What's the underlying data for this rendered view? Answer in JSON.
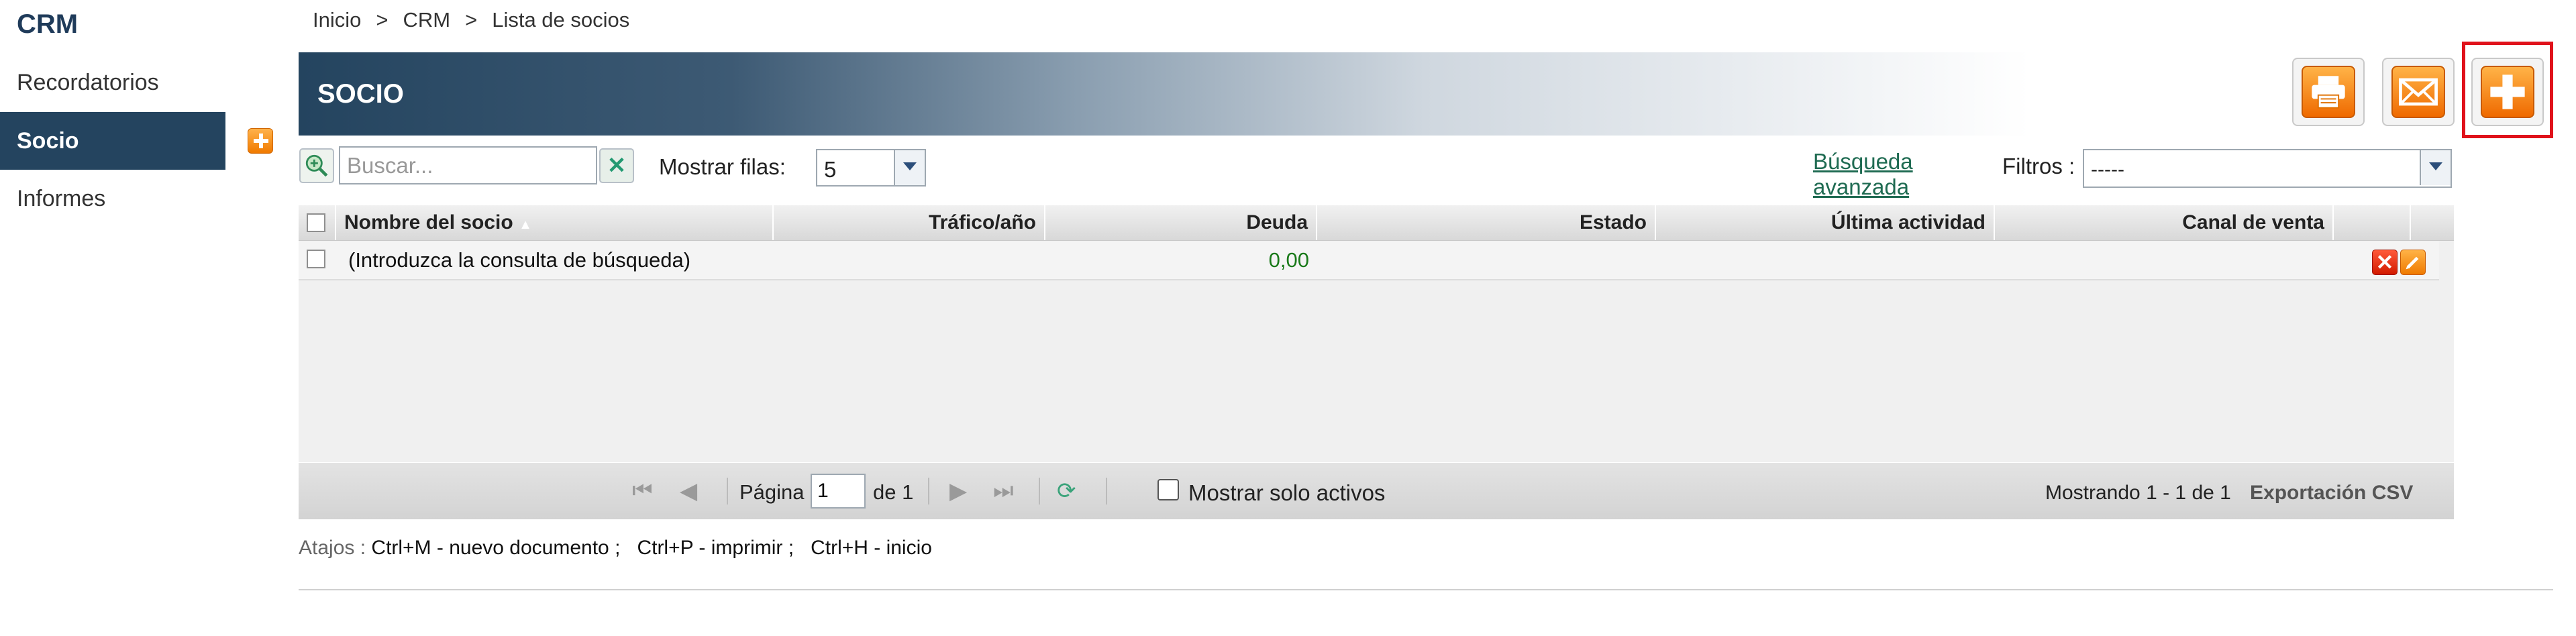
{
  "sidebar": {
    "title": "CRM",
    "items": [
      {
        "label": "Recordatorios"
      },
      {
        "label": "Socio"
      },
      {
        "label": "Informes"
      }
    ]
  },
  "breadcrumb": [
    "Inicio",
    ">",
    "CRM",
    ">",
    "Lista de socios"
  ],
  "header": {
    "title": "SOCIO"
  },
  "toolbar": {
    "print_icon": "printer-icon",
    "email_icon": "envelope-icon",
    "add_icon": "plus-icon",
    "accent": "#f07a00",
    "highlight_color": "#e0121b"
  },
  "search": {
    "placeholder": "Buscar...",
    "value": ""
  },
  "rows_control": {
    "label": "Mostrar filas:",
    "value": "5"
  },
  "advanced_search": {
    "line1": "Búsqueda",
    "line2": "avanzada"
  },
  "filters": {
    "label": "Filtros :",
    "value": "-----"
  },
  "table": {
    "columns": [
      "Nombre del socio",
      "Tráfico/año",
      "Deuda",
      "Estado",
      "Última actividad",
      "Canal de venta"
    ],
    "sort_indicator": "▲",
    "rows": [
      {
        "name": "(Introduzca la consulta de búsqueda)",
        "traffic": "",
        "debt": "0,00",
        "status": "",
        "last_activity": "",
        "channel": ""
      }
    ]
  },
  "pager": {
    "page_label": "Página",
    "page_value": "1",
    "of_label": "de 1",
    "active_only_label": "Mostrar solo activos",
    "showing": "Mostrando 1 - 1 de 1",
    "csv": "Exportación CSV"
  },
  "shortcuts": {
    "label": "Atajos :",
    "items": [
      "Ctrl+M - nuevo documento ;",
      "Ctrl+P - imprimir ;",
      "Ctrl+H - inicio"
    ]
  }
}
